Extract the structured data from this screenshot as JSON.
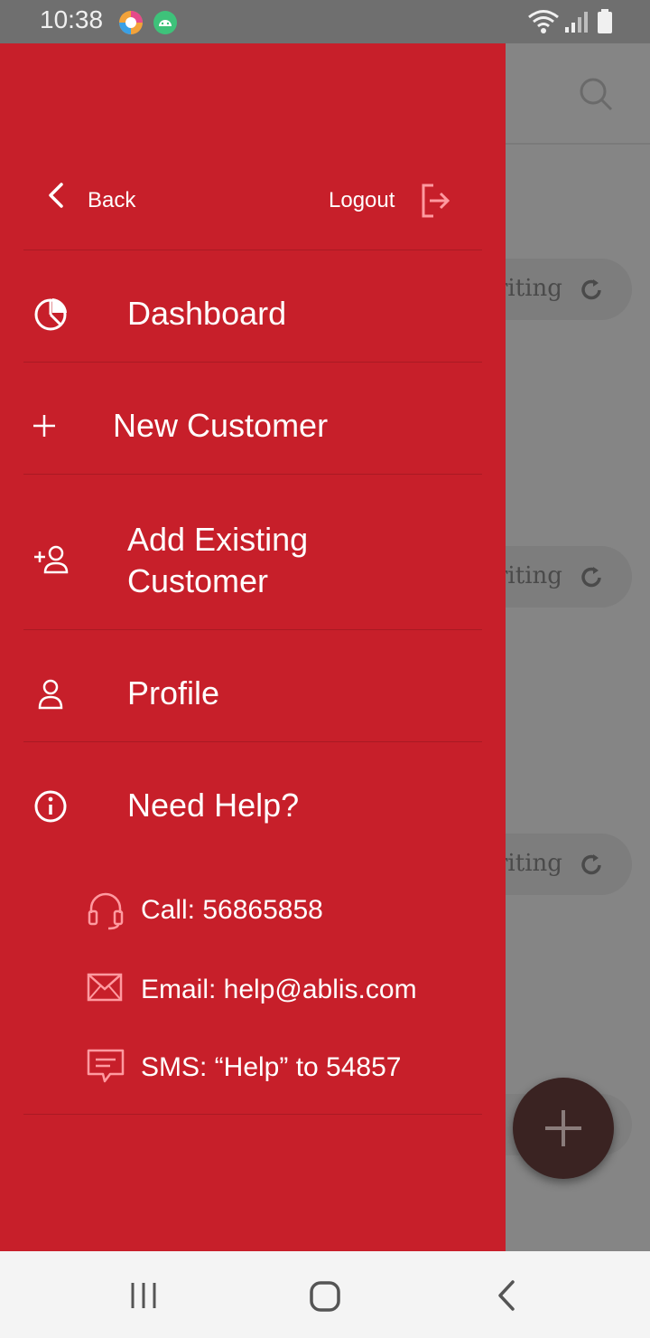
{
  "status_bar": {
    "time": "10:38",
    "left_icons": [
      "browser-app-icon",
      "android-icon"
    ],
    "right_icons": [
      "wifi-icon",
      "signal-icon",
      "battery-icon"
    ]
  },
  "drawer": {
    "background": "#c71f2a",
    "header": {
      "back_label": "Back",
      "logout_label": "Logout"
    },
    "menu": [
      {
        "id": "dashboard",
        "label": "Dashboard",
        "icon": "pie-chart-icon"
      },
      {
        "id": "new-customer",
        "label": "New Customer",
        "icon": "plus-icon"
      },
      {
        "id": "add-existing-customer",
        "label_line1": "Add Existing",
        "label_line2": "Customer",
        "icon": "add-user-icon"
      },
      {
        "id": "profile",
        "label": "Profile",
        "icon": "user-icon"
      },
      {
        "id": "need-help",
        "label": "Need Help?",
        "icon": "info-icon"
      }
    ],
    "help": [
      {
        "id": "call",
        "text": "Call: 56865858",
        "icon": "headset-icon"
      },
      {
        "id": "email",
        "text": "Email: help@ablis.com",
        "icon": "mail-icon"
      },
      {
        "id": "sms",
        "text": "SMS: “Help” to 54857",
        "icon": "message-icon"
      }
    ]
  },
  "background_screen": {
    "search_icon": "search-icon",
    "pills": [
      "riting",
      "riting",
      "riting"
    ],
    "fab_icon": "plus-icon"
  },
  "nav_bar": {
    "icons": [
      "recent-apps-icon",
      "home-icon",
      "back-icon"
    ]
  }
}
